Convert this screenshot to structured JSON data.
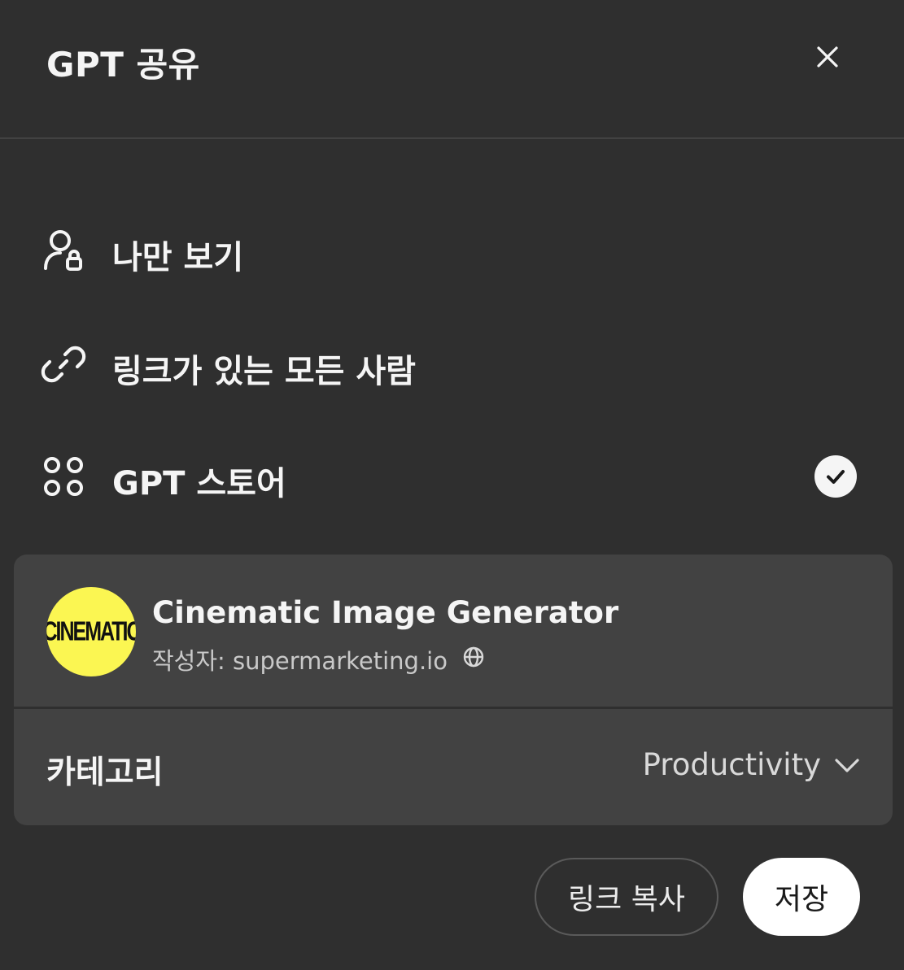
{
  "header": {
    "title": "GPT 공유"
  },
  "options": [
    {
      "label": "나만 보기",
      "icon": "user-lock-icon",
      "selected": false
    },
    {
      "label": "링크가 있는 모든 사람",
      "icon": "link-icon",
      "selected": false
    },
    {
      "label": "GPT 스토어",
      "icon": "apps-grid-icon",
      "selected": true
    }
  ],
  "gpt": {
    "avatar_text": "CINEMATIC",
    "name": "Cinematic Image Generator",
    "author": "작성자: supermarketing.io"
  },
  "category": {
    "label": "카테고리",
    "value": "Productivity"
  },
  "buttons": {
    "copy_link": "링크 복사",
    "save": "저장"
  },
  "colors": {
    "background": "#2f2f2f",
    "card": "#424242",
    "avatar": "#fbf652",
    "text": "#f5f5f5"
  }
}
